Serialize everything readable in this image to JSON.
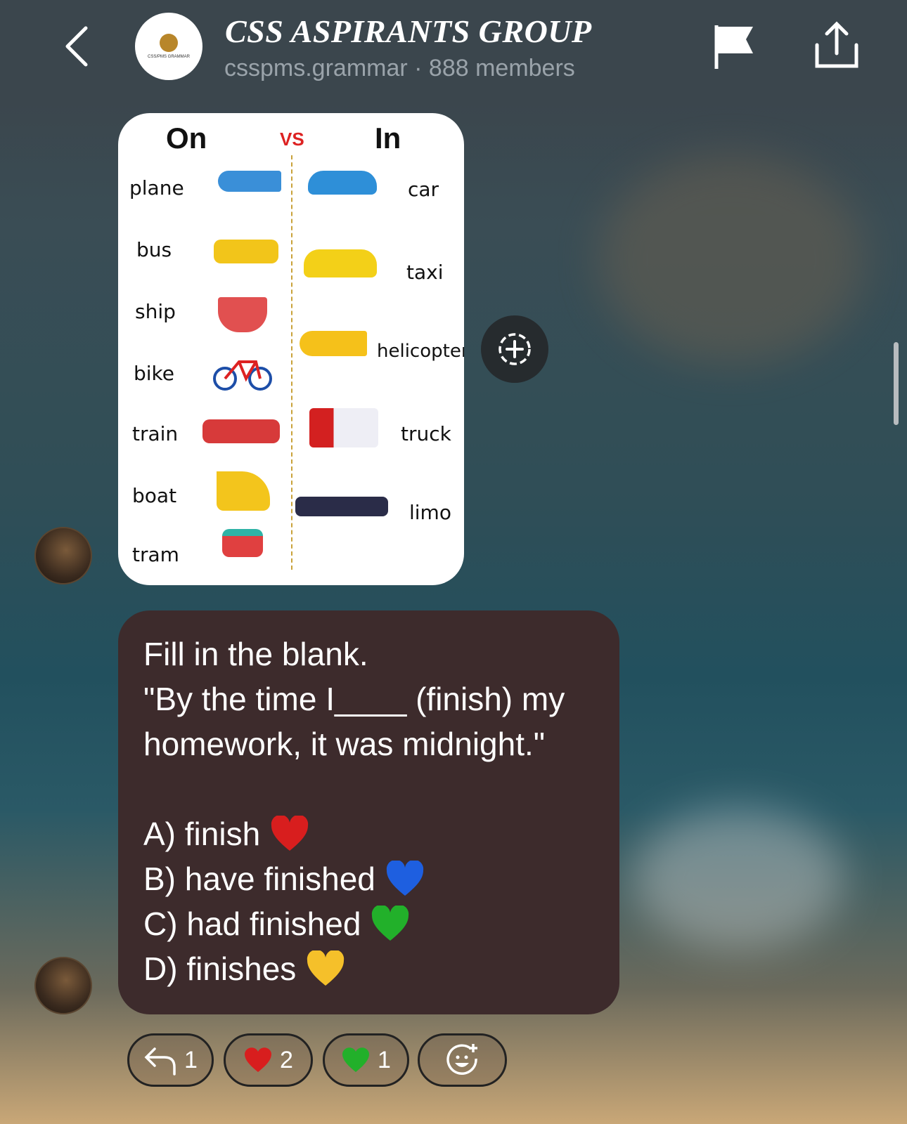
{
  "header": {
    "title": "CSS ASPIRANTS GROUP",
    "handle": "csspms.grammar",
    "members": "· 888 members",
    "logo_text": "CSS/PMS GRAMMAR"
  },
  "image_card": {
    "left_heading": "On",
    "vs": "VS",
    "right_heading": "In",
    "on_words": [
      "plane",
      "bus",
      "ship",
      "bike",
      "train",
      "boat",
      "tram"
    ],
    "in_words": [
      "car",
      "taxi",
      "helicopter",
      "truck",
      "limo"
    ]
  },
  "message": {
    "lines": [
      "Fill in the blank.",
      "\"By the time I____ (finish) my",
      "homework, it was midnight.\""
    ],
    "options": [
      {
        "text": "A) finish",
        "heart": "#d81e1e"
      },
      {
        "text": "B) have finished",
        "heart": "#1e5fe0"
      },
      {
        "text": "C) had finished",
        "heart": "#22b02a"
      },
      {
        "text": "D) finishes",
        "heart": "#f5c02a"
      }
    ]
  },
  "reactions": [
    {
      "icon": "reply-icon",
      "count": "1"
    },
    {
      "icon": "red-heart",
      "color": "#d81e1e",
      "count": "2"
    },
    {
      "icon": "green-heart",
      "color": "#22b02a",
      "count": "1"
    },
    {
      "icon": "add-reaction-icon"
    }
  ]
}
